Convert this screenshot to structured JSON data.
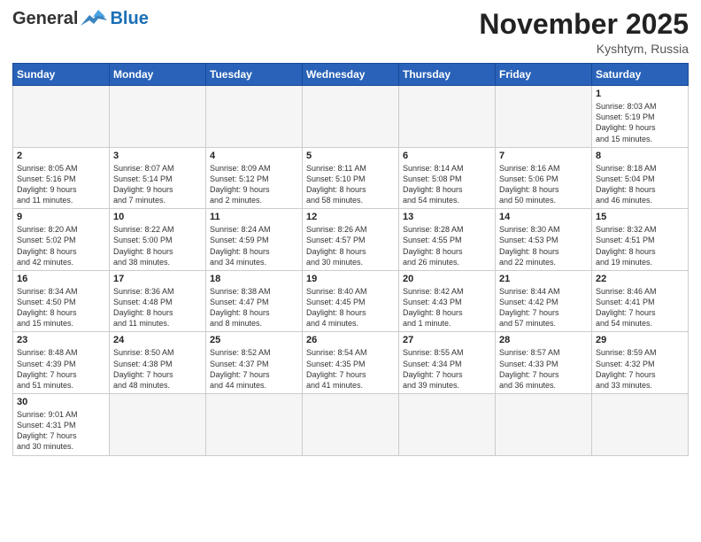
{
  "header": {
    "logo": {
      "general": "General",
      "blue": "Blue"
    },
    "title": "November 2025",
    "location": "Kyshtym, Russia"
  },
  "weekdays": [
    "Sunday",
    "Monday",
    "Tuesday",
    "Wednesday",
    "Thursday",
    "Friday",
    "Saturday"
  ],
  "weeks": [
    [
      {
        "day": "",
        "info": ""
      },
      {
        "day": "",
        "info": ""
      },
      {
        "day": "",
        "info": ""
      },
      {
        "day": "",
        "info": ""
      },
      {
        "day": "",
        "info": ""
      },
      {
        "day": "",
        "info": ""
      },
      {
        "day": "1",
        "info": "Sunrise: 8:03 AM\nSunset: 5:19 PM\nDaylight: 9 hours\nand 15 minutes."
      }
    ],
    [
      {
        "day": "2",
        "info": "Sunrise: 8:05 AM\nSunset: 5:16 PM\nDaylight: 9 hours\nand 11 minutes."
      },
      {
        "day": "3",
        "info": "Sunrise: 8:07 AM\nSunset: 5:14 PM\nDaylight: 9 hours\nand 7 minutes."
      },
      {
        "day": "4",
        "info": "Sunrise: 8:09 AM\nSunset: 5:12 PM\nDaylight: 9 hours\nand 2 minutes."
      },
      {
        "day": "5",
        "info": "Sunrise: 8:11 AM\nSunset: 5:10 PM\nDaylight: 8 hours\nand 58 minutes."
      },
      {
        "day": "6",
        "info": "Sunrise: 8:14 AM\nSunset: 5:08 PM\nDaylight: 8 hours\nand 54 minutes."
      },
      {
        "day": "7",
        "info": "Sunrise: 8:16 AM\nSunset: 5:06 PM\nDaylight: 8 hours\nand 50 minutes."
      },
      {
        "day": "8",
        "info": "Sunrise: 8:18 AM\nSunset: 5:04 PM\nDaylight: 8 hours\nand 46 minutes."
      }
    ],
    [
      {
        "day": "9",
        "info": "Sunrise: 8:20 AM\nSunset: 5:02 PM\nDaylight: 8 hours\nand 42 minutes."
      },
      {
        "day": "10",
        "info": "Sunrise: 8:22 AM\nSunset: 5:00 PM\nDaylight: 8 hours\nand 38 minutes."
      },
      {
        "day": "11",
        "info": "Sunrise: 8:24 AM\nSunset: 4:59 PM\nDaylight: 8 hours\nand 34 minutes."
      },
      {
        "day": "12",
        "info": "Sunrise: 8:26 AM\nSunset: 4:57 PM\nDaylight: 8 hours\nand 30 minutes."
      },
      {
        "day": "13",
        "info": "Sunrise: 8:28 AM\nSunset: 4:55 PM\nDaylight: 8 hours\nand 26 minutes."
      },
      {
        "day": "14",
        "info": "Sunrise: 8:30 AM\nSunset: 4:53 PM\nDaylight: 8 hours\nand 22 minutes."
      },
      {
        "day": "15",
        "info": "Sunrise: 8:32 AM\nSunset: 4:51 PM\nDaylight: 8 hours\nand 19 minutes."
      }
    ],
    [
      {
        "day": "16",
        "info": "Sunrise: 8:34 AM\nSunset: 4:50 PM\nDaylight: 8 hours\nand 15 minutes."
      },
      {
        "day": "17",
        "info": "Sunrise: 8:36 AM\nSunset: 4:48 PM\nDaylight: 8 hours\nand 11 minutes."
      },
      {
        "day": "18",
        "info": "Sunrise: 8:38 AM\nSunset: 4:47 PM\nDaylight: 8 hours\nand 8 minutes."
      },
      {
        "day": "19",
        "info": "Sunrise: 8:40 AM\nSunset: 4:45 PM\nDaylight: 8 hours\nand 4 minutes."
      },
      {
        "day": "20",
        "info": "Sunrise: 8:42 AM\nSunset: 4:43 PM\nDaylight: 8 hours\nand 1 minute."
      },
      {
        "day": "21",
        "info": "Sunrise: 8:44 AM\nSunset: 4:42 PM\nDaylight: 7 hours\nand 57 minutes."
      },
      {
        "day": "22",
        "info": "Sunrise: 8:46 AM\nSunset: 4:41 PM\nDaylight: 7 hours\nand 54 minutes."
      }
    ],
    [
      {
        "day": "23",
        "info": "Sunrise: 8:48 AM\nSunset: 4:39 PM\nDaylight: 7 hours\nand 51 minutes."
      },
      {
        "day": "24",
        "info": "Sunrise: 8:50 AM\nSunset: 4:38 PM\nDaylight: 7 hours\nand 48 minutes."
      },
      {
        "day": "25",
        "info": "Sunrise: 8:52 AM\nSunset: 4:37 PM\nDaylight: 7 hours\nand 44 minutes."
      },
      {
        "day": "26",
        "info": "Sunrise: 8:54 AM\nSunset: 4:35 PM\nDaylight: 7 hours\nand 41 minutes."
      },
      {
        "day": "27",
        "info": "Sunrise: 8:55 AM\nSunset: 4:34 PM\nDaylight: 7 hours\nand 39 minutes."
      },
      {
        "day": "28",
        "info": "Sunrise: 8:57 AM\nSunset: 4:33 PM\nDaylight: 7 hours\nand 36 minutes."
      },
      {
        "day": "29",
        "info": "Sunrise: 8:59 AM\nSunset: 4:32 PM\nDaylight: 7 hours\nand 33 minutes."
      }
    ],
    [
      {
        "day": "30",
        "info": "Sunrise: 9:01 AM\nSunset: 4:31 PM\nDaylight: 7 hours\nand 30 minutes."
      },
      {
        "day": "",
        "info": ""
      },
      {
        "day": "",
        "info": ""
      },
      {
        "day": "",
        "info": ""
      },
      {
        "day": "",
        "info": ""
      },
      {
        "day": "",
        "info": ""
      },
      {
        "day": "",
        "info": ""
      }
    ]
  ]
}
